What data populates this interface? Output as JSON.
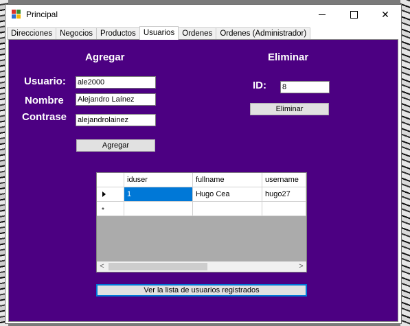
{
  "window": {
    "title": "Principal"
  },
  "tabs": [
    "Direcciones",
    "Negocios",
    "Productos",
    "Usuarios",
    "Ordenes",
    "Ordenes (Administrador)"
  ],
  "agregar": {
    "heading": "Agregar",
    "usuario_label": "Usuario:",
    "usuario_value": "ale2000",
    "nombre_label": "Nombre",
    "nombre_value": "Alejandro Laínez",
    "contrase_label": "Contrase",
    "contrase_value": "alejandrolainez",
    "button": "Agregar"
  },
  "eliminar": {
    "heading": "Eliminar",
    "id_label": "ID:",
    "id_value": "8",
    "button": "Eliminar"
  },
  "grid": {
    "columns": [
      "iduser",
      "fullname",
      "username"
    ],
    "rows": [
      {
        "iduser": "1",
        "fullname": "Hugo Cea",
        "username": "hugo27"
      }
    ],
    "new_row_marker": "*"
  },
  "list_button": "Ver la lista de usuarios registrados",
  "colors": {
    "panel": "#4c0082",
    "selection": "#0078d7"
  }
}
